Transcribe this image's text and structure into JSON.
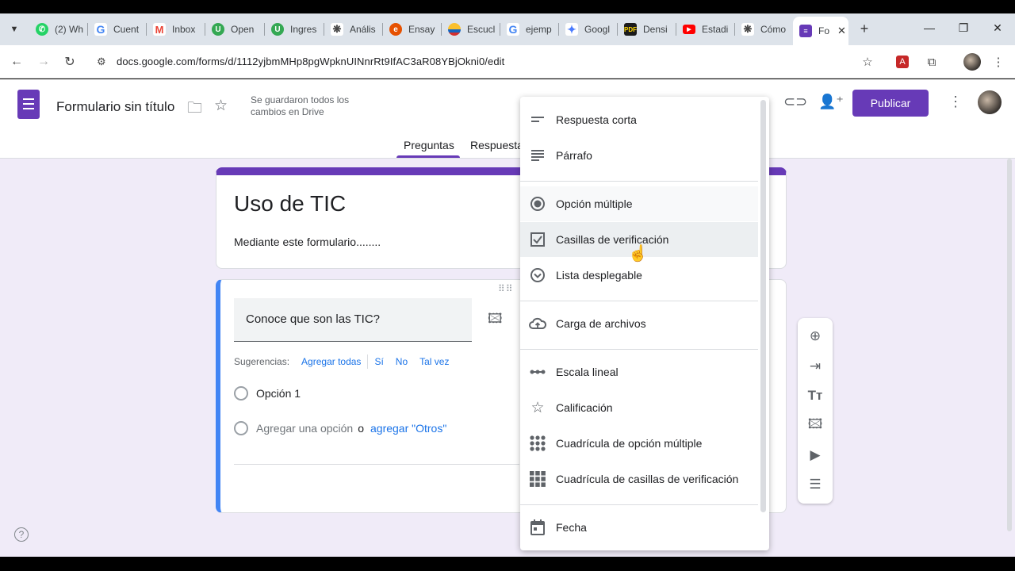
{
  "browser": {
    "tabs": [
      {
        "label": "(2) Wh",
        "icon": "whatsapp-icon",
        "color": "#25d366"
      },
      {
        "label": "Cuent",
        "icon": "google-icon",
        "color": "#4285f4"
      },
      {
        "label": "Inbox",
        "icon": "gmail-icon",
        "color": "#ea4335"
      },
      {
        "label": "Open",
        "icon": "shield-icon",
        "color": "#34a853"
      },
      {
        "label": "Ingres",
        "icon": "shield-icon",
        "color": "#34a853"
      },
      {
        "label": "Anális",
        "icon": "openai-icon",
        "color": "#444444"
      },
      {
        "label": "Ensay",
        "icon": "circle-icon",
        "color": "#e65100"
      },
      {
        "label": "Escucl",
        "icon": "flag-icon",
        "color": "#fbc02d"
      },
      {
        "label": "ejemp",
        "icon": "google-icon",
        "color": "#4285f4"
      },
      {
        "label": "Googl",
        "icon": "gemini-icon",
        "color": "#4a7bff"
      },
      {
        "label": "Densi",
        "icon": "pdf-icon",
        "color": "#1b1b1b"
      },
      {
        "label": "Estadi",
        "icon": "youtube-icon",
        "color": "#ff0000"
      },
      {
        "label": "Cómo",
        "icon": "openai-icon",
        "color": "#444444"
      },
      {
        "label": "Fo",
        "icon": "forms-icon",
        "color": "#673ab7"
      }
    ],
    "url": "docs.google.com/forms/d/1112yjbmMHp8pgWpknUINnrRt9IfAC3aR08YBjOkni0/edit"
  },
  "header": {
    "title": "Formulario sin título",
    "saved_line1": "Se guardaron todos los",
    "saved_line2": "cambios en Drive",
    "publish": "Publicar",
    "tab_questions": "Preguntas",
    "tab_responses": "Respuesta"
  },
  "title_card": {
    "title": "Uso de TIC",
    "description": "Mediante este formulario........"
  },
  "question": {
    "text": "Conoce que son las TIC?",
    "suggestions_label": "Sugerencias:",
    "suggest_all": "Agregar todas",
    "chips": [
      "Sí",
      "No",
      "Tal vez"
    ],
    "option1": "Opción 1",
    "add_option": "Agregar una opción",
    "or": "o",
    "add_other": "agregar \"Otros\""
  },
  "menu": {
    "items": [
      {
        "label": "Respuesta corta",
        "icon": "short-text-icon"
      },
      {
        "label": "Párrafo",
        "icon": "paragraph-icon"
      },
      {
        "label": "Opción múltiple",
        "icon": "radio-button-icon"
      },
      {
        "label": "Casillas de verificación",
        "icon": "checkbox-icon"
      },
      {
        "label": "Lista desplegable",
        "icon": "dropdown-icon"
      },
      {
        "label": "Carga de archivos",
        "icon": "cloud-upload-icon"
      },
      {
        "label": "Escala lineal",
        "icon": "linear-scale-icon"
      },
      {
        "label": "Calificación",
        "icon": "star-icon"
      },
      {
        "label": "Cuadrícula de opción múltiple",
        "icon": "dot-grid-icon"
      },
      {
        "label": "Cuadrícula de casillas de verificación",
        "icon": "square-grid-icon"
      },
      {
        "label": "Fecha",
        "icon": "calendar-icon"
      }
    ]
  },
  "colors": {
    "accent": "#673ab7",
    "link": "#1a73e8",
    "question_border": "#4285f4",
    "background": "#f0ebf8"
  }
}
